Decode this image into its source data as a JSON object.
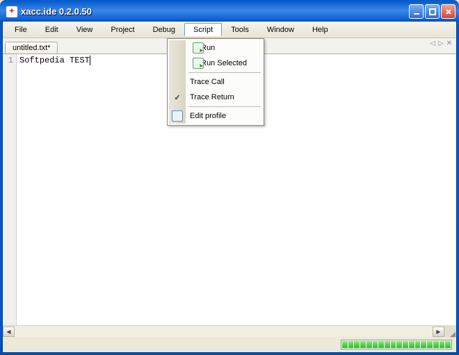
{
  "window": {
    "title": "xacc.ide 0.2.0.50"
  },
  "menubar": {
    "items": [
      "File",
      "Edit",
      "View",
      "Project",
      "Debug",
      "Script",
      "Tools",
      "Window",
      "Help"
    ],
    "active_index": 5
  },
  "tab": {
    "label": "untitled.txt*"
  },
  "editor": {
    "line_number": "1",
    "content": "Softpedia TEST"
  },
  "dropdown": {
    "items": [
      {
        "label": "Run",
        "icon": "run-icon",
        "checked": false
      },
      {
        "label": "Run Selected",
        "icon": "runsel-icon",
        "checked": false
      }
    ],
    "items2": [
      {
        "label": "Trace Call",
        "icon": "",
        "checked": false
      },
      {
        "label": "Trace Return",
        "icon": "",
        "checked": true
      }
    ],
    "items3": [
      {
        "label": "Edit profile",
        "icon": "profile-icon",
        "checked": false
      }
    ]
  },
  "progress": {
    "segments": 18
  }
}
